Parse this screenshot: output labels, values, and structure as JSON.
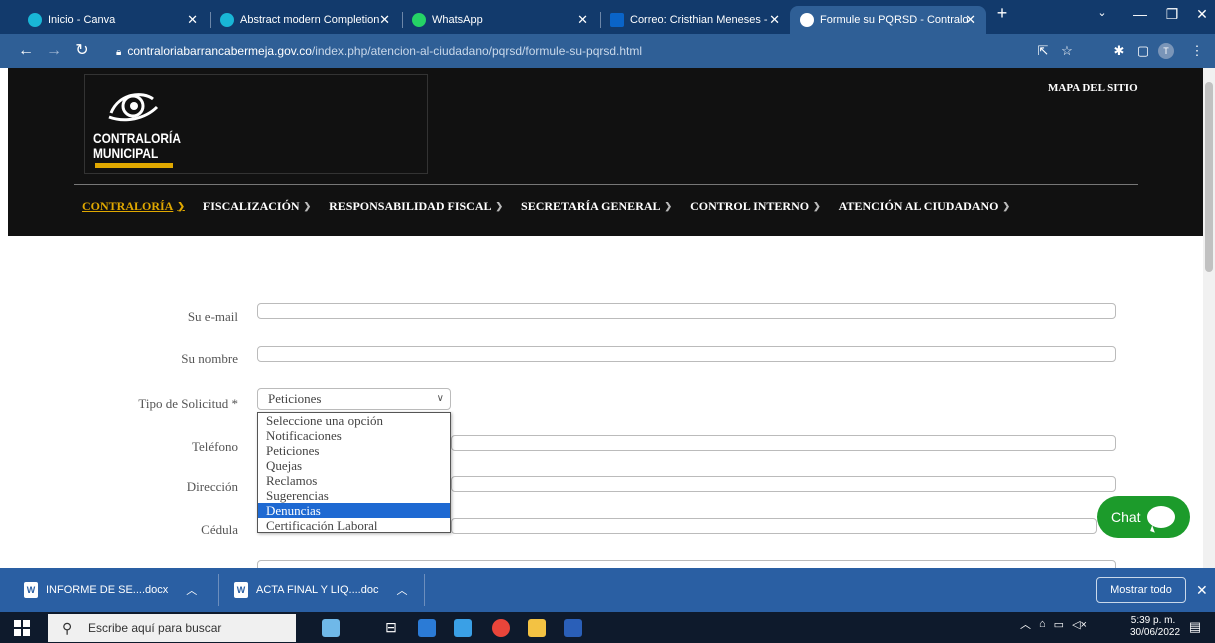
{
  "browser": {
    "tabs": [
      {
        "title": "Inicio - Canva",
        "favicon_color": "#19b6d6"
      },
      {
        "title": "Abstract modern Completion",
        "favicon_color": "#19b6d6"
      },
      {
        "title": "WhatsApp",
        "favicon_color": "#25d366"
      },
      {
        "title": "Correo: Cristhian Meneses -",
        "favicon_color": "#0a64c8"
      },
      {
        "title": "Formule su PQRSD - Contralo",
        "favicon_color": "#ffffff",
        "active": true
      }
    ],
    "new_tab": "+",
    "url_host": "contraloriabarrancabermeja.gov.co",
    "url_path": "/index.php/atencion-al-ciudadano/pqrsd/formule-su-pqrsd.html",
    "profile_initial": "T"
  },
  "site": {
    "logo_line1": "CONTRALORÍA",
    "logo_line2": "MUNICIPAL",
    "sitemap": "MAPA DEL SITIO",
    "nav": [
      {
        "label": "CONTRALORÍA",
        "active": true
      },
      {
        "label": "FISCALIZACIÓN"
      },
      {
        "label": "RESPONSABILIDAD FISCAL"
      },
      {
        "label": "SECRETARÍA GENERAL"
      },
      {
        "label": "CONTROL INTERNO"
      },
      {
        "label": "ATENCIÓN AL CIUDADANO"
      }
    ]
  },
  "form": {
    "email_label": "Su e-mail",
    "name_label": "Su nombre",
    "type_label": "Tipo de Solicitud *",
    "type_value": "Peticiones",
    "phone_label": "Teléfono",
    "address_label": "Dirección",
    "id_label": "Cédula",
    "type_options": [
      "Seleccione una opción",
      "Notificaciones",
      "Peticiones",
      "Quejas",
      "Reclamos",
      "Sugerencias",
      "Denuncias",
      "Certificación Laboral"
    ],
    "highlighted_option": "Denuncias"
  },
  "chat": {
    "label": "Chat",
    "color": "#1c9b2b"
  },
  "downloads": {
    "items": [
      {
        "name": "INFORME DE SE....docx"
      },
      {
        "name": "ACTA FINAL Y LIQ....doc"
      }
    ],
    "show_all": "Mostrar todo"
  },
  "taskbar": {
    "search_placeholder": "Escribe aquí para buscar",
    "time": "5:39 p. m.",
    "date": "30/06/2022"
  },
  "colors": {
    "accent": "#e0a800",
    "chrome": "#2f5f96",
    "selection": "#1e69d2"
  }
}
